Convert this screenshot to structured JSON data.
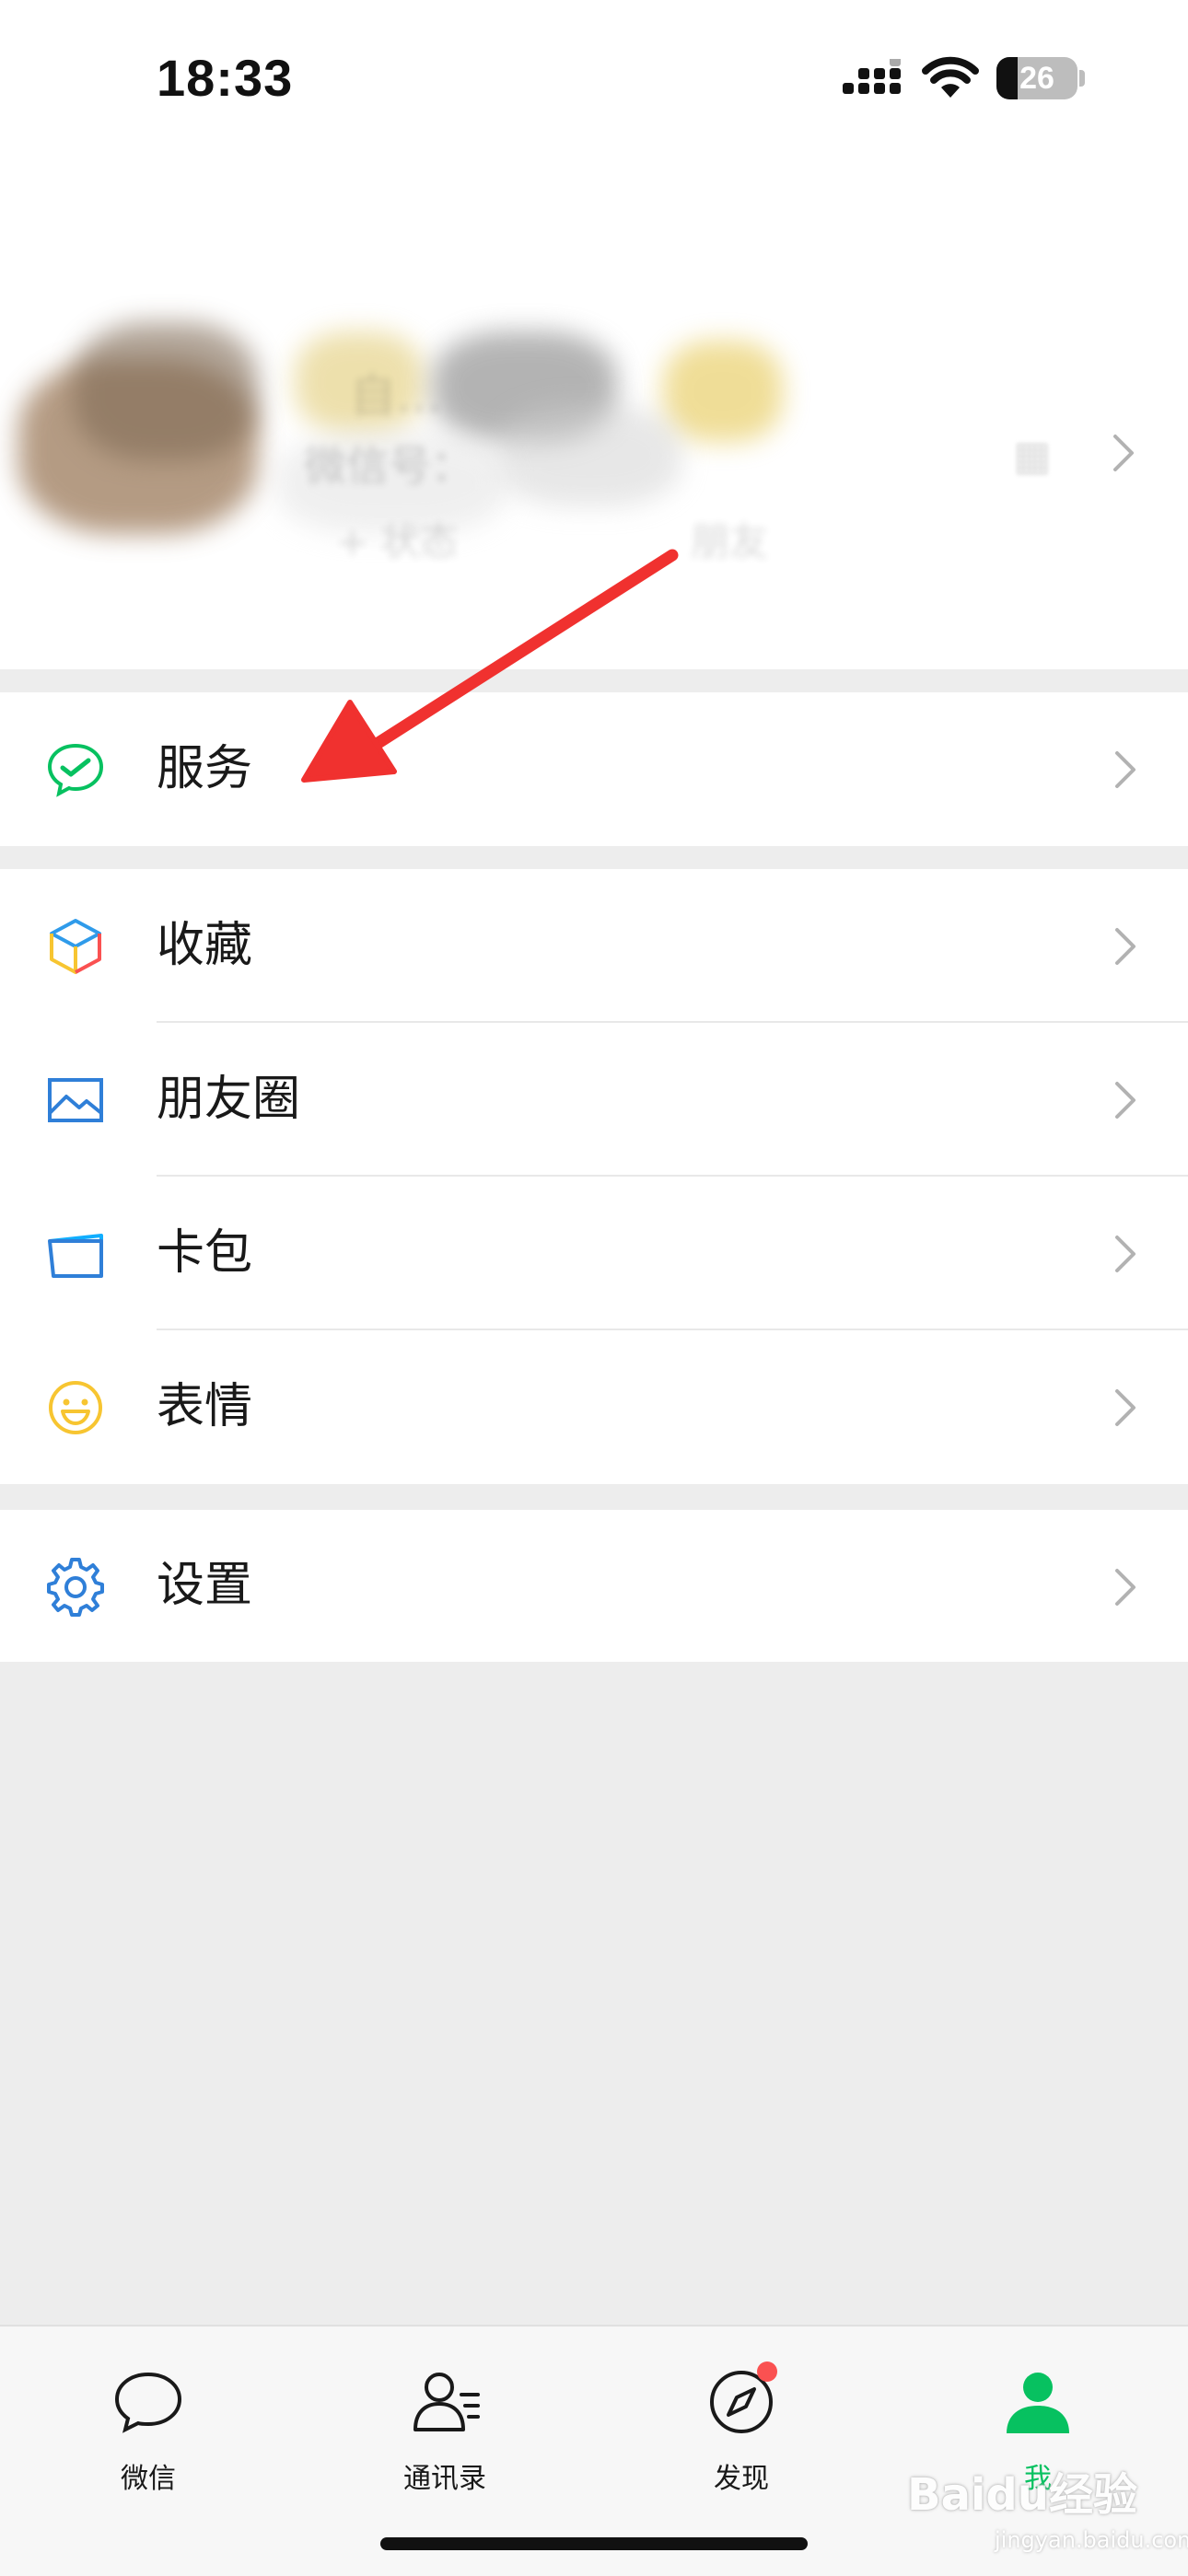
{
  "status_bar": {
    "time": "18:33",
    "battery": "26",
    "battery_level": 0.26
  },
  "profile": {
    "name": "自…",
    "wechat_id": "微信号：",
    "status": "+ 状态",
    "friends": "朋友",
    "qr_icon": "qr-code-icon"
  },
  "menu": {
    "services": {
      "label": "服务",
      "icon": "wechat-pay-icon"
    },
    "favorites": {
      "label": "收藏",
      "icon": "cube-icon"
    },
    "moments": {
      "label": "朋友圈",
      "icon": "picture-icon"
    },
    "cards": {
      "label": "卡包",
      "icon": "card-icon"
    },
    "stickers": {
      "label": "表情",
      "icon": "smiley-icon"
    },
    "settings": {
      "label": "设置",
      "icon": "gear-icon"
    }
  },
  "tabs": [
    {
      "label": "微信",
      "icon": "chat-bubble-icon"
    },
    {
      "label": "通讯录",
      "icon": "contacts-icon"
    },
    {
      "label": "发现",
      "icon": "compass-icon",
      "badge": true
    },
    {
      "label": "我",
      "icon": "person-icon",
      "active": true
    }
  ],
  "watermark": {
    "text": "Baidu经验",
    "sub": "jingyan.baidu.com"
  },
  "colors": {
    "accent": "#07c160",
    "arrow": "#f0312f",
    "badge": "#fa5151",
    "background": "#ededed"
  }
}
